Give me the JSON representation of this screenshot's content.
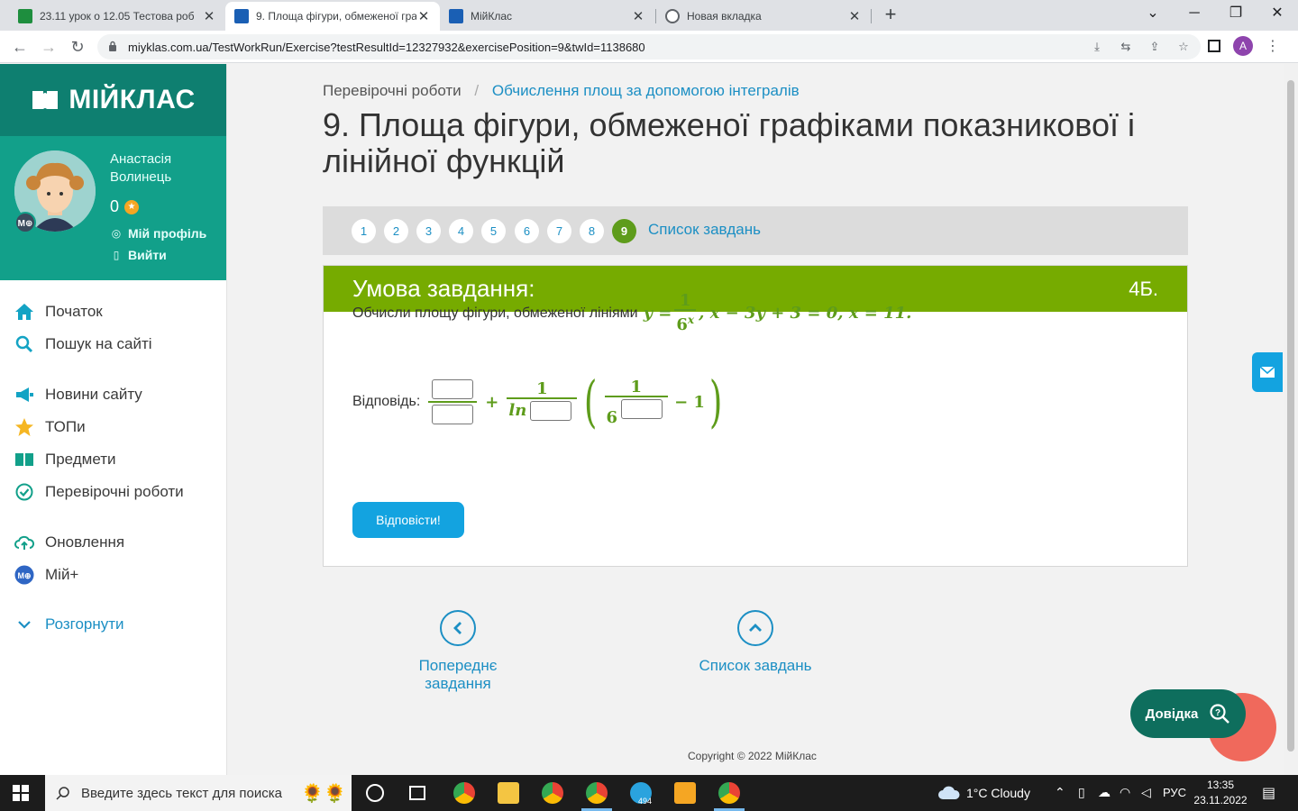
{
  "browser": {
    "tabs": [
      {
        "title": "23.11 урок о 12.05 Тестова роб"
      },
      {
        "title": "9. Площа фігури, обмеженої гра"
      },
      {
        "title": "МійКлас"
      },
      {
        "title": "Новая вкладка"
      }
    ],
    "url": "miyklas.com.ua/TestWorkRun/Exercise?testResultId=12327932&exercisePosition=9&twId=1138680",
    "profile_initial": "A"
  },
  "sidebar": {
    "logo": "МІЙКЛАС",
    "user_name": "Анастасія Волинець",
    "points": "0",
    "badge": "M⊕",
    "profile_link": "Мій профіль",
    "logout_link": "Вийти",
    "menu": [
      {
        "label": "Початок"
      },
      {
        "label": "Пошук на сайті"
      },
      {
        "label": "Новини сайту"
      },
      {
        "label": "ТОПи"
      },
      {
        "label": "Предмети"
      },
      {
        "label": "Перевірочні роботи"
      },
      {
        "label": "Оновлення"
      },
      {
        "label": "Мій+"
      },
      {
        "label": "Розгорнути"
      }
    ],
    "colors": {
      "header": "#0e7f70",
      "user": "#12a08a"
    }
  },
  "main": {
    "breadcrumb": {
      "root": "Перевірочні роботи",
      "separator": "/",
      "current": "Обчислення площ за допомогою інтегралів"
    },
    "title": "9. Площа фігури, обмеженої графіками показникової і лінійної функцій",
    "pager": {
      "pages": [
        "1",
        "2",
        "3",
        "4",
        "5",
        "6",
        "7",
        "8",
        "9"
      ],
      "current": "9",
      "list_link": "Список завдань"
    },
    "task": {
      "header": "Умова завдання:",
      "points": "4Б.",
      "prompt": "Обчисли площу фігури, обмеженої лініями",
      "formula": {
        "y_eq": "y =",
        "num": "1",
        "den_base": "6",
        "den_exp": "x",
        "rest": ", x − 3y + 3 = 0, x = 11."
      },
      "answer_label": "Відповідь:",
      "answer_formula": {
        "plus": "+",
        "num1": "1",
        "ln": "ln",
        "inner_num": "1",
        "inner_base": "6",
        "minus_one": "− 1"
      },
      "inputs": [
        "",
        "",
        "",
        ""
      ],
      "submit": "Відповісти!",
      "accent": "#76ab00"
    },
    "nav": {
      "prev": "Попереднє завдання",
      "list": "Список завдань"
    },
    "copyright": "Copyright © 2022 МійКлас",
    "help": "Довідка"
  },
  "taskbar": {
    "search_placeholder": "Введите здесь текст для поиска",
    "weather": "1°C  Cloudy",
    "lang": "РУС",
    "time": "13:35",
    "date": "23.11.2022",
    "telegram_badge": "494"
  }
}
